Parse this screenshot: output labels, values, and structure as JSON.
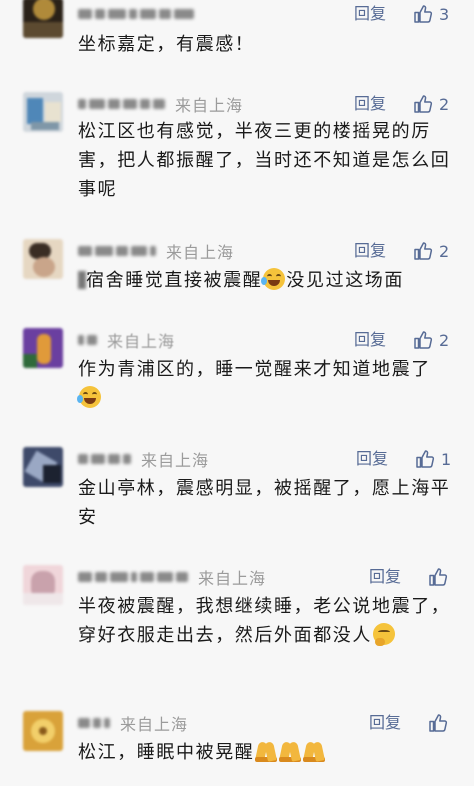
{
  "comments": [
    {
      "location": "",
      "reply_label": "回复",
      "like_count": "3",
      "liked": false,
      "text": "坐标嘉定，有震感！",
      "avatar_colors": [
        "#2a2118",
        "#b08a3a",
        "#5c4a30"
      ]
    },
    {
      "location": "来自上海",
      "reply_label": "回复",
      "like_count": "2",
      "liked": false,
      "text": "松江区也有感觉，半夜三更的楼摇晃的厉害，把人都振醒了，当时还不知道是怎么回事呢",
      "avatar_colors": [
        "#cfd6dc",
        "#4f87b8",
        "#e8e2d0"
      ]
    },
    {
      "location": "来自上海",
      "reply_label": "回复",
      "like_count": "2",
      "liked": false,
      "text_before": "宿舍睡觉直接被震醒",
      "emoji": "laugh",
      "text_after": "没见过这场面",
      "avatar_colors": [
        "#e6d7c2",
        "#3a2d24",
        "#c9a58a"
      ]
    },
    {
      "location": "来自上海",
      "reply_label": "回复",
      "like_count": "2",
      "liked": false,
      "text_before": "作为青浦区的，睡一觉醒来才知道地震了",
      "emoji": "laugh",
      "text_after": "",
      "avatar_colors": [
        "#6a3fa0",
        "#e09a3a",
        "#2f6a3a"
      ]
    },
    {
      "location": "来自上海",
      "reply_label": "回复",
      "like_count": "1",
      "liked": false,
      "text": "金山亭林，震感明显，被摇醒了，愿上海平安",
      "avatar_colors": [
        "#3e4a6a",
        "#9aa8c4",
        "#1c2230"
      ]
    },
    {
      "location": "来自上海",
      "reply_label": "回复",
      "like_count": "",
      "liked": false,
      "text_before": "半夜被震醒，我想继续睡，老公说地震了，穿好衣服走出去，然后外面都没人",
      "emoji": "think",
      "text_after": "",
      "avatar_colors": [
        "#f0d6da",
        "#c9a2ac",
        "#efe7e9"
      ]
    },
    {
      "location": "来自上海",
      "reply_label": "回复",
      "like_count": "",
      "liked": false,
      "text_before": "松江，睡眠中被晃醒",
      "emoji": "pray",
      "emoji_repeat": 3,
      "text_after": "",
      "avatar_colors": [
        "#d9a23a",
        "#f2cf6a",
        "#8a5a1a"
      ]
    }
  ]
}
